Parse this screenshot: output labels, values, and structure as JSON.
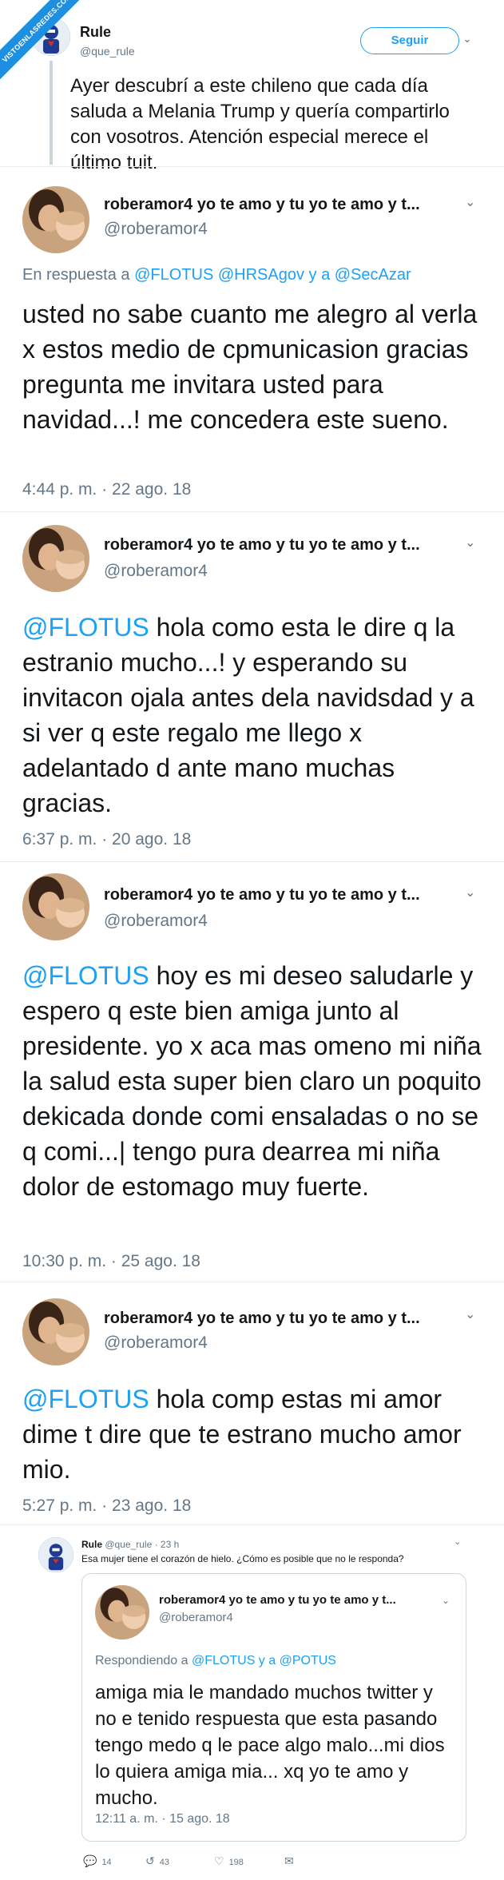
{
  "watermark": "VISTOENLASREDES.COM",
  "header_tweet": {
    "name": "Rule",
    "handle": "@que_rule",
    "follow_label": "Seguir",
    "text": "Ayer descubrí a este chileno que cada día saluda a Melania Trump y quería compartirlo con vosotros. Atención especial merece el último tuit."
  },
  "tweets": [
    {
      "name": "roberamor4 yo te amo y tu yo te amo y t...",
      "handle": "@roberamor4",
      "reply_prefix": "En respuesta a",
      "reply_to": "@FLOTUS @HRSAgov y a @SecAzar",
      "mention": "",
      "text": "usted no sabe cuanto me alegro al verla x estos medio de cpmunicasion gracias pregunta me invitara usted para navidad...! me concedera este sueno.",
      "time": "4:44 p. m. · 22 ago. 18"
    },
    {
      "name": "roberamor4 yo te amo y tu yo te amo y t...",
      "handle": "@roberamor4",
      "mention": "@FLOTUS",
      "text": " hola como esta le dire q la estranio mucho...! y esperando su invitacon ojala antes dela navidsdad y a si ver q este regalo me llego x adelantado d ante mano muchas gracias.",
      "time": "6:37 p. m. · 20 ago. 18"
    },
    {
      "name": "roberamor4 yo te amo y tu yo te amo y t...",
      "handle": "@roberamor4",
      "mention": "@FLOTUS",
      "text": " hoy es mi deseo saludarle y espero q este bien amiga junto al presidente. yo x aca mas omeno mi niña la salud esta super bien claro un poquito dekicada donde comi ensaladas o no se q comi...| tengo pura dearrea mi niña dolor de estomago muy fuerte.",
      "time": "10:30 p. m. · 25 ago. 18"
    },
    {
      "name": "roberamor4 yo te amo y tu yo te amo y t...",
      "handle": "@roberamor4",
      "mention": "@FLOTUS",
      "text": " hola comp estas mi amor dime t dire que te estrano mucho amor mio.",
      "time": "5:27 p. m. · 23 ago. 18"
    }
  ],
  "quote_tweet": {
    "name": "Rule",
    "handle_time": "@que_rule · 23 h",
    "text": "Esa mujer tiene el corazón de hielo. ¿Cómo es posible que no le responda?",
    "card": {
      "name": "roberamor4 yo te amo y tu yo te amo y t...",
      "handle": "@roberamor4",
      "reply_prefix": "Respondiendo a",
      "reply_to": "@FLOTUS y a @POTUS",
      "text": "amiga mia le mandado muchos twitter y no e tenido respuesta que esta pasando tengo medo q le pace algo malo...mi dios lo quiera amiga mia... xq yo te amo y mucho.",
      "time": "12:11 a. m. · 15 ago. 18"
    },
    "actions": {
      "replies": "14",
      "retweets": "43",
      "likes": "198"
    }
  },
  "colors": {
    "accent": "#1da1f2",
    "muted": "#657786",
    "text": "#14171a",
    "border": "#e6ecf0"
  }
}
